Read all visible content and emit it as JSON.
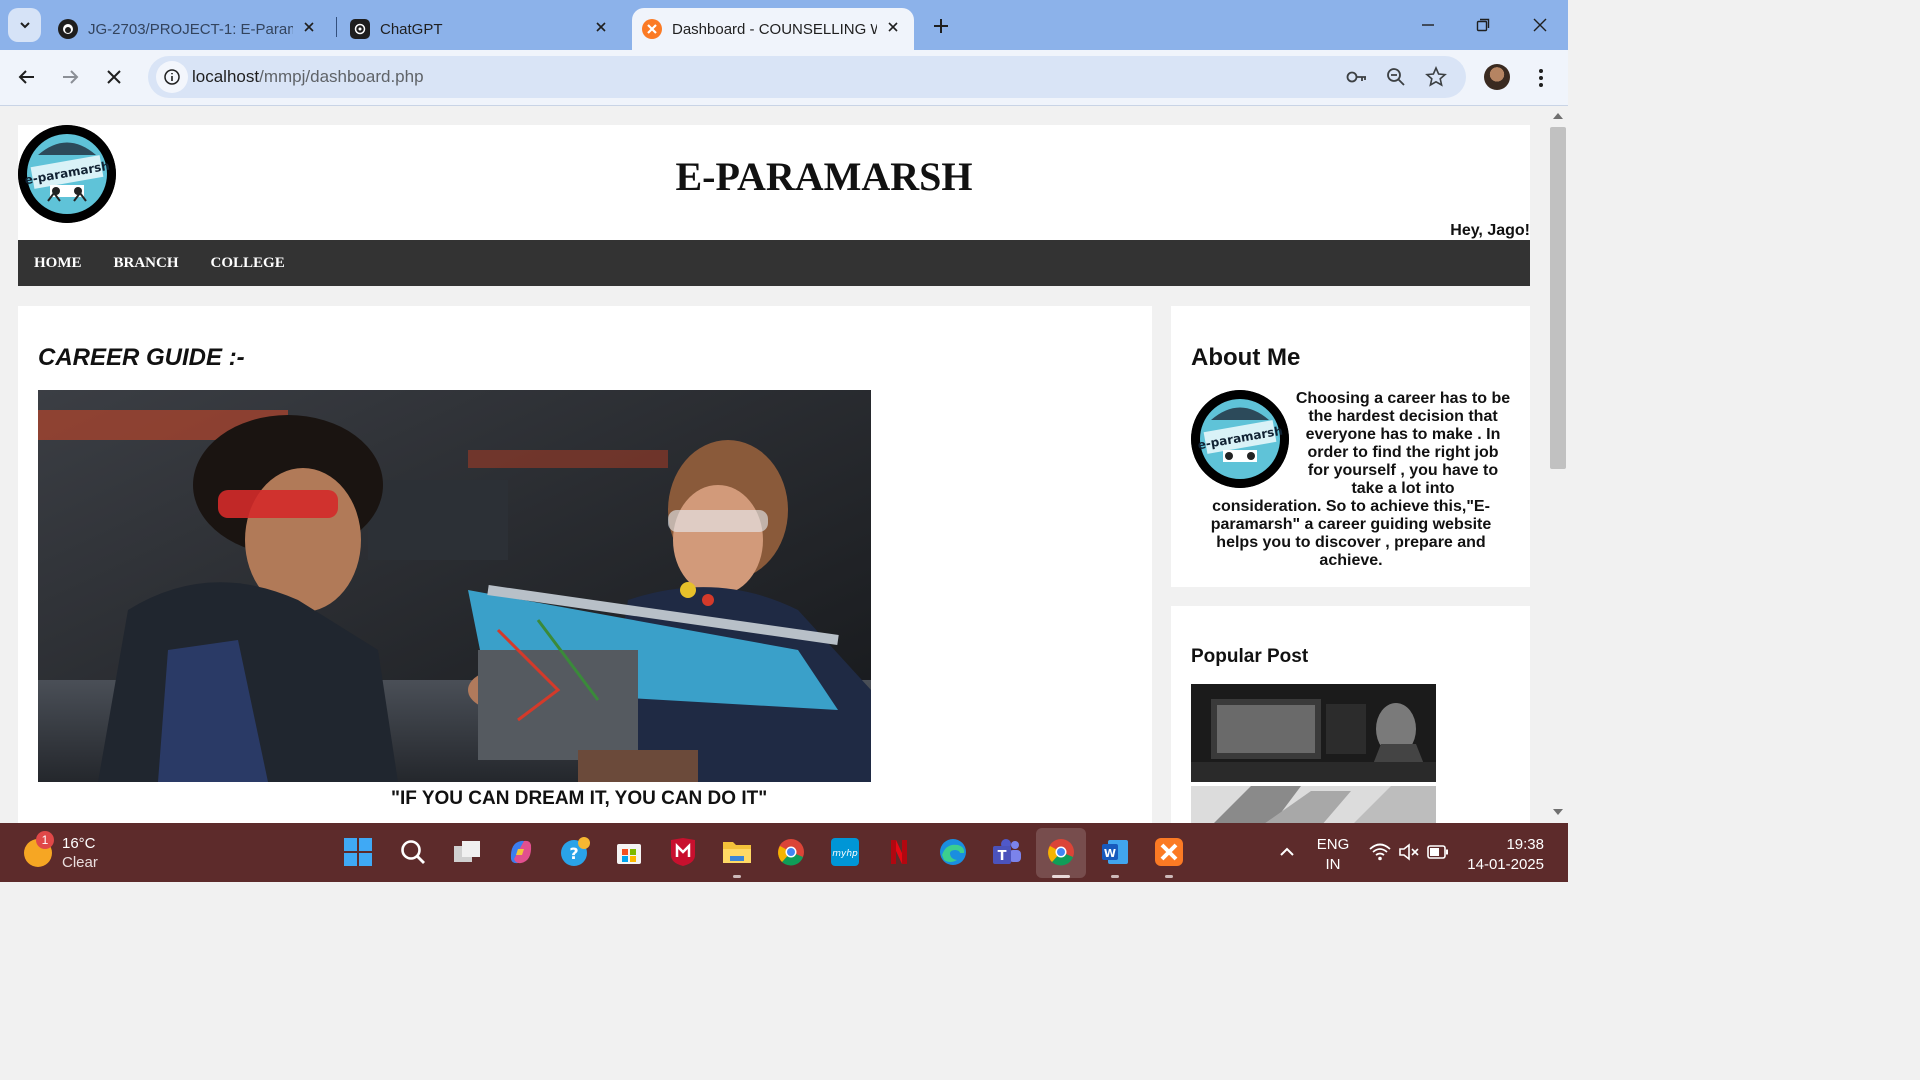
{
  "browser": {
    "tabs": [
      {
        "title": "JG-2703/PROJECT-1: E-Paramar",
        "icon": "github-icon"
      },
      {
        "title": "ChatGPT",
        "icon": "chatgpt-icon"
      },
      {
        "title": "Dashboard - COUNSELLING WE",
        "icon": "xampp-icon",
        "active": true
      }
    ],
    "url_host": "localhost",
    "url_path": "/mmpj/dashboard.php"
  },
  "site": {
    "title": "E-PARAMARSH",
    "greeting": "Hey, Jago!",
    "logo_text": "e-paramarsh",
    "nav": [
      "HOME",
      "BRANCH",
      "COLLEGE"
    ]
  },
  "main": {
    "heading": "CAREER GUIDE :-",
    "quote": "\"IF YOU CAN DREAM IT, YOU CAN DO IT\""
  },
  "sidebar": {
    "about_title": "About Me",
    "about_text": "Choosing a career has to be the hardest decision that everyone has to make . In order to find the right job for yourself , you have to take a lot into consideration. So to achieve this,\"E-paramarsh\" a career guiding website helps you to discover , prepare and achieve.",
    "popular_title": "Popular Post"
  },
  "taskbar": {
    "weather_badge": "1",
    "temperature": "16°C",
    "condition": "Clear",
    "lang_line1": "ENG",
    "lang_line2": "IN",
    "time": "19:38",
    "date": "14-01-2025"
  },
  "colors": {
    "tabbar": "#8cb2ea",
    "toolbar": "#f0f4fb",
    "nav_bar": "#333333",
    "taskbar": "#5d2b2b"
  }
}
